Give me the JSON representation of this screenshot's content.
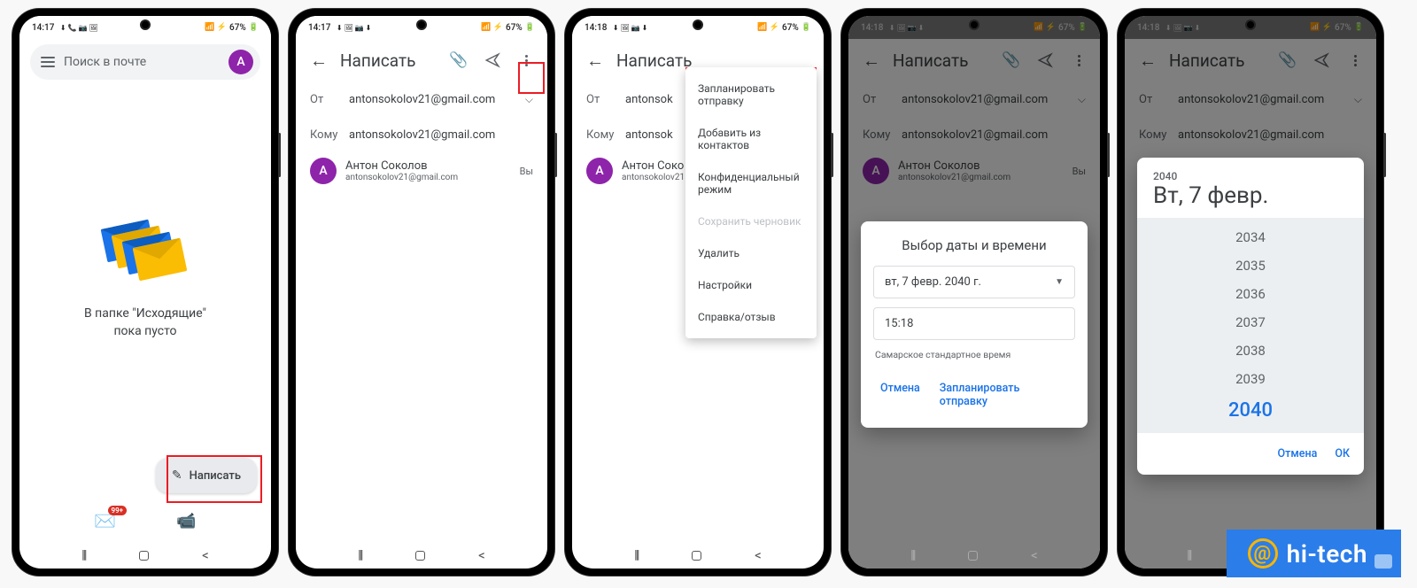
{
  "status": {
    "time1": "14:17",
    "time2": "14:18",
    "battery": "67%",
    "icons_left": "⬇📞📷🖼",
    "icons_right": "📶"
  },
  "s1": {
    "search_placeholder": "Поиск в почте",
    "avatar_letter": "А",
    "empty_l1": "В папке \"Исходящие\"",
    "empty_l2": "пока пусто",
    "compose": "Написать",
    "badge": "99+"
  },
  "compose": {
    "title": "Написать",
    "from_label": "От",
    "from_value": "antonsokolov21@gmail.com",
    "to_label": "Кому",
    "to_value": "antonsokolov21@gmail.com",
    "contact_name": "Антон Соколов",
    "contact_email": "antonsokolov21@gmail.com",
    "contact_letter": "А",
    "you": "Вы"
  },
  "menu": {
    "schedule": "Запланировать отправку",
    "contacts": "Добавить из контактов",
    "confidential": "Конфиденциальный режим",
    "save_draft": "Сохранить черновик",
    "delete": "Удалить",
    "settings": "Настройки",
    "help": "Справка/отзыв"
  },
  "s4": {
    "modal_title": "Выбор даты и времени",
    "date": "вт, 7 февр. 2040 г.",
    "time": "15:18",
    "tz": "Самарское стандартное время",
    "cancel": "Отмена",
    "confirm": "Запланировать отправку"
  },
  "s5": {
    "year_sup": "2040",
    "year_main": "Вт, 7 февр.",
    "years": [
      "2034",
      "2035",
      "2036",
      "2037",
      "2038",
      "2039"
    ],
    "year_selected": "2040",
    "cancel": "Отмена",
    "ok": "ОК"
  },
  "watermark": "hi-tech"
}
